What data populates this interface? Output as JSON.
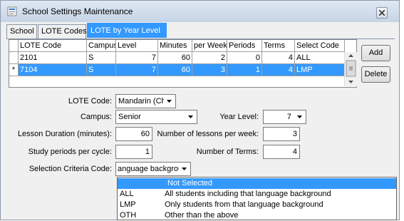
{
  "window": {
    "title": "School Settings Maintenance"
  },
  "tabs": [
    {
      "label": "School"
    },
    {
      "label": "LOTE Codes"
    },
    {
      "label": "LOTE by Year Level"
    }
  ],
  "grid": {
    "columns": [
      "LOTE Code",
      "Campus",
      "Level",
      "Minutes",
      "per Week",
      "Periods",
      "Terms",
      "Select Code"
    ],
    "rows": [
      {
        "marker": "",
        "values": [
          "2101",
          "S",
          "7",
          "60",
          "2",
          "0",
          "4",
          "ALL"
        ]
      },
      {
        "marker": "*",
        "values": [
          "7104",
          "S",
          "7",
          "60",
          "3",
          "1",
          "4",
          "LMP"
        ]
      }
    ]
  },
  "buttons": {
    "add": "Add",
    "delete": "Delete"
  },
  "form": {
    "lote_code_label": "LOTE Code:",
    "lote_code_value": "Mandarin (Chi",
    "campus_label": "Campus:",
    "campus_value": "Senior",
    "year_level_label": "Year Level:",
    "year_level_value": "7",
    "lesson_duration_label": "Lesson Duration (minutes):",
    "lesson_duration_value": "60",
    "lessons_per_week_label": "Number of lessons per week:",
    "lessons_per_week_value": "3",
    "study_periods_label": "Study periods per cycle:",
    "study_periods_value": "1",
    "terms_label": "Number of Terms:",
    "terms_value": "4",
    "selection_label": "Selection Criteria Code:",
    "selection_value": "anguage backgrou"
  },
  "dropdown_options": [
    {
      "code": "",
      "desc": "Not Selected"
    },
    {
      "code": "ALL",
      "desc": "All students including that language background"
    },
    {
      "code": "LMP",
      "desc": "Only students from that language background"
    },
    {
      "code": "OTH",
      "desc": "Other than the above"
    }
  ],
  "colors": {
    "selection": "#3399ff",
    "titlebar": "#c5d4e6"
  }
}
